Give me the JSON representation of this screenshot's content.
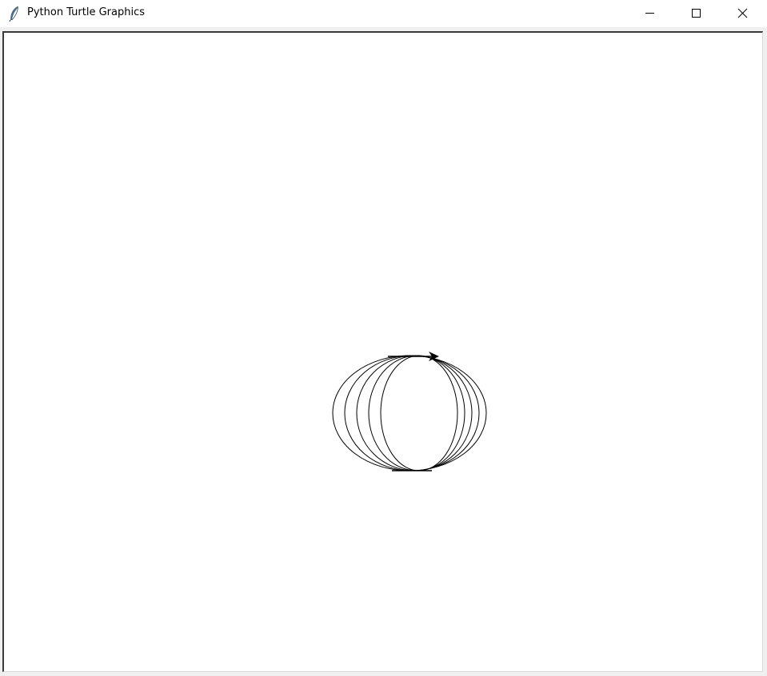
{
  "window": {
    "title": "Python Turtle Graphics",
    "icon": "feather-icon",
    "controls": {
      "minimize": "minimize-icon",
      "maximize": "maximize-icon",
      "close": "close-icon"
    }
  },
  "canvas": {
    "background": "#ffffff",
    "pen_color": "#000000",
    "drawing": "five overlapping circles",
    "turtle": {
      "shape": "classic",
      "heading": "east",
      "color": "#000000"
    }
  }
}
